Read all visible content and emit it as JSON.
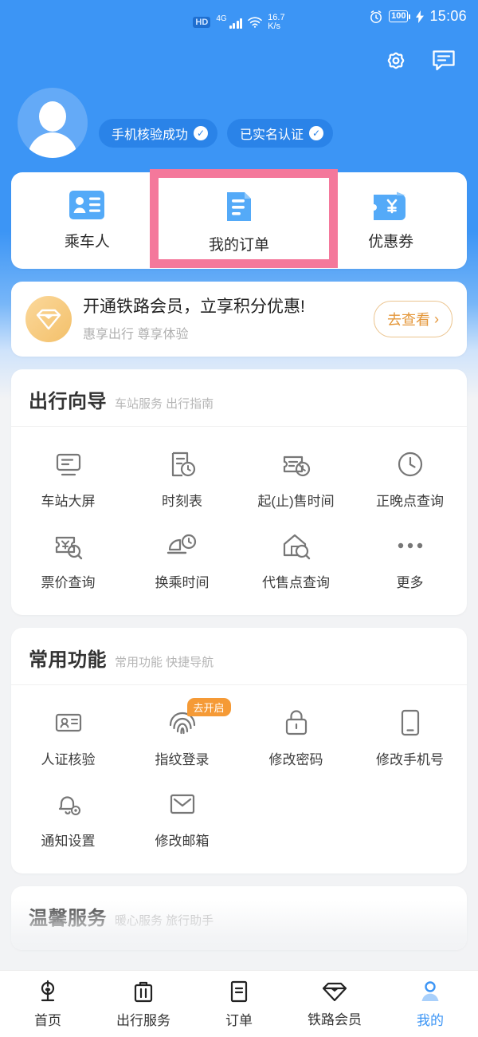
{
  "statusbar": {
    "hd": "HD",
    "network": "4G",
    "speed_value": "16.7",
    "speed_unit": "K/s",
    "battery": "100",
    "time": "15:06",
    "alarm_icon": "alarm-icon",
    "charging_icon": "charging-bolt-icon",
    "wifi_icon": "wifi-icon",
    "signal_icon": "signal-bars-icon"
  },
  "header": {
    "settings_icon": "gear-icon",
    "message_icon": "message-icon",
    "avatar": "avatar",
    "badges": [
      {
        "label": "手机核验成功",
        "check": "✓"
      },
      {
        "label": "已实名认证",
        "check": "✓"
      }
    ]
  },
  "quick_actions": {
    "items": [
      {
        "label": "乘车人",
        "icon": "id-card-icon"
      },
      {
        "label": "我的订单",
        "icon": "order-document-icon"
      },
      {
        "label": "优惠券",
        "icon": "coupon-wallet-icon"
      }
    ],
    "highlight_index": 1,
    "highlight_color": "#F4789B"
  },
  "member_banner": {
    "icon": "diamond-member-icon",
    "title": "开通铁路会员，立享积分优惠!",
    "subtitle": "惠享出行 尊享体验",
    "button_label": "去查看",
    "button_chevron": "›",
    "accent_color": "#E4973A"
  },
  "sections": [
    {
      "title": "出行向导",
      "subtitle": "车站服务 出行指南",
      "items": [
        {
          "label": "车站大屏",
          "icon": "station-screen-icon"
        },
        {
          "label": "时刻表",
          "icon": "timetable-icon"
        },
        {
          "label": "起(止)售时间",
          "icon": "ticket-clock-icon"
        },
        {
          "label": "正晚点查询",
          "icon": "clock-icon"
        },
        {
          "label": "票价查询",
          "icon": "fare-search-icon"
        },
        {
          "label": "换乘时间",
          "icon": "transfer-time-icon"
        },
        {
          "label": "代售点查询",
          "icon": "agency-search-icon"
        },
        {
          "label": "更多",
          "icon": "more-dots-icon"
        }
      ]
    },
    {
      "title": "常用功能",
      "subtitle": "常用功能 快捷导航",
      "items": [
        {
          "label": "人证核验",
          "icon": "id-verify-icon"
        },
        {
          "label": "指纹登录",
          "icon": "fingerprint-icon",
          "tag": "去开启"
        },
        {
          "label": "修改密码",
          "icon": "lock-icon"
        },
        {
          "label": "修改手机号",
          "icon": "phone-icon"
        },
        {
          "label": "通知设置",
          "icon": "bell-settings-icon"
        },
        {
          "label": "修改邮箱",
          "icon": "envelope-icon"
        }
      ]
    },
    {
      "title": "温馨服务",
      "subtitle": "暖心服务 旅行助手",
      "items": []
    }
  ],
  "bottom_nav": {
    "active_index": 4,
    "active_color": "#3C95F5",
    "items": [
      {
        "label": "首页",
        "icon": "railway-home-icon"
      },
      {
        "label": "出行服务",
        "icon": "suitcase-icon"
      },
      {
        "label": "订单",
        "icon": "order-list-icon"
      },
      {
        "label": "铁路会员",
        "icon": "diamond-icon"
      },
      {
        "label": "我的",
        "icon": "person-icon"
      }
    ]
  }
}
